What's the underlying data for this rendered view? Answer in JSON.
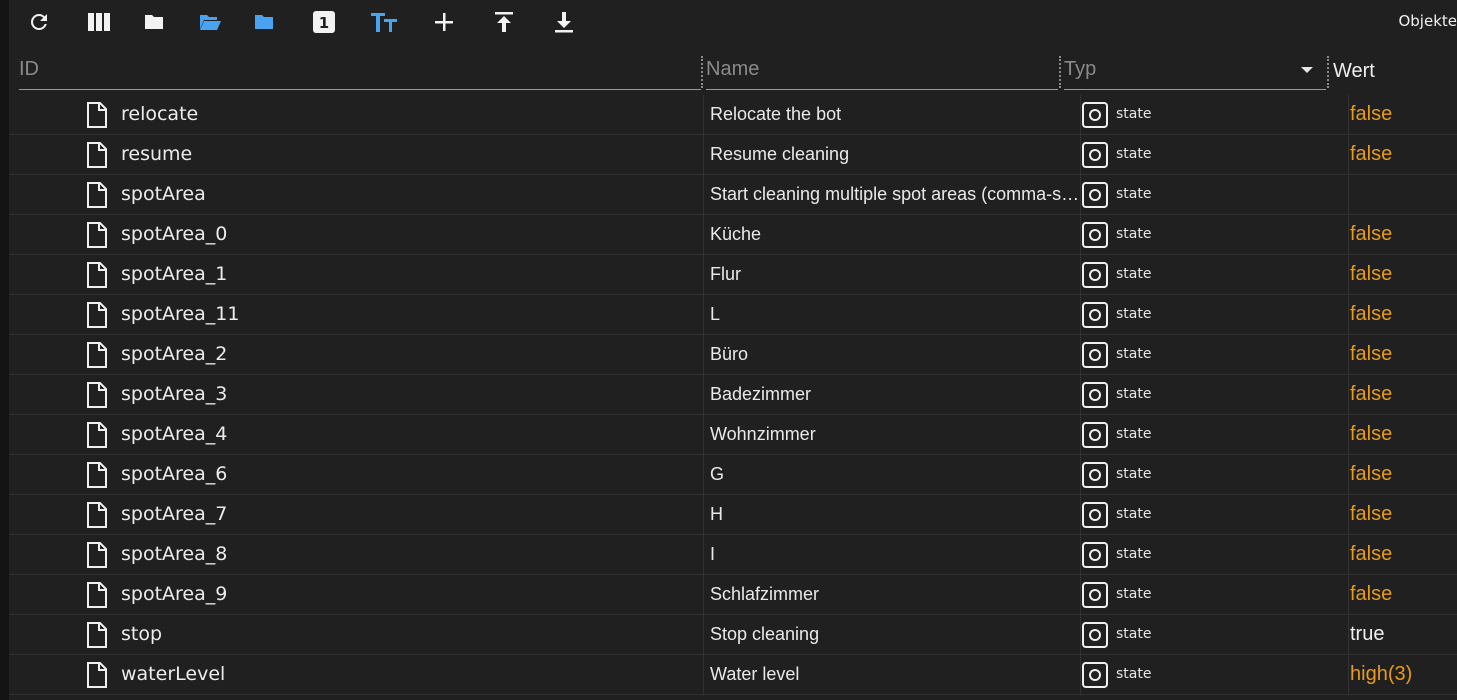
{
  "toolbar": {
    "objects_label": "Objekte",
    "buttons": [
      {
        "name": "refresh-icon"
      },
      {
        "name": "columns-icon"
      },
      {
        "name": "folder-icon"
      },
      {
        "name": "folder-open-icon"
      },
      {
        "name": "folder-blue-icon"
      },
      {
        "name": "number-one-icon"
      },
      {
        "name": "text-size-icon"
      },
      {
        "name": "plus-icon"
      },
      {
        "name": "upload-icon"
      },
      {
        "name": "download-icon"
      }
    ]
  },
  "header": {
    "id_placeholder": "ID",
    "name_placeholder": "Name",
    "typ_placeholder": "Typ",
    "wert_label": "Wert"
  },
  "colors": {
    "background": "#202020",
    "accent_blue": "#4aa3f0",
    "value_orange": "#e89a1a"
  },
  "rows": [
    {
      "id": "relocate",
      "name": "Relocate the bot",
      "typ": "state",
      "value": "false"
    },
    {
      "id": "resume",
      "name": "Resume cleaning",
      "typ": "state",
      "value": "false"
    },
    {
      "id": "spotArea",
      "name": "Start cleaning multiple spot areas (comma-separated list)",
      "typ": "state",
      "value": ""
    },
    {
      "id": "spotArea_0",
      "name": "Küche",
      "typ": "state",
      "value": "false"
    },
    {
      "id": "spotArea_1",
      "name": "Flur",
      "typ": "state",
      "value": "false"
    },
    {
      "id": "spotArea_11",
      "name": "L",
      "typ": "state",
      "value": "false"
    },
    {
      "id": "spotArea_2",
      "name": "Büro",
      "typ": "state",
      "value": "false"
    },
    {
      "id": "spotArea_3",
      "name": "Badezimmer",
      "typ": "state",
      "value": "false"
    },
    {
      "id": "spotArea_4",
      "name": "Wohnzimmer",
      "typ": "state",
      "value": "false"
    },
    {
      "id": "spotArea_6",
      "name": "G",
      "typ": "state",
      "value": "false"
    },
    {
      "id": "spotArea_7",
      "name": "H",
      "typ": "state",
      "value": "false"
    },
    {
      "id": "spotArea_8",
      "name": "I",
      "typ": "state",
      "value": "false"
    },
    {
      "id": "spotArea_9",
      "name": "Schlafzimmer",
      "typ": "state",
      "value": "false"
    },
    {
      "id": "stop",
      "name": "Stop cleaning",
      "typ": "state",
      "value": "true",
      "value_color": "#f0f0f0"
    },
    {
      "id": "waterLevel",
      "name": "Water level",
      "typ": "state",
      "value": "high",
      "value_suffix": "(3)"
    }
  ]
}
